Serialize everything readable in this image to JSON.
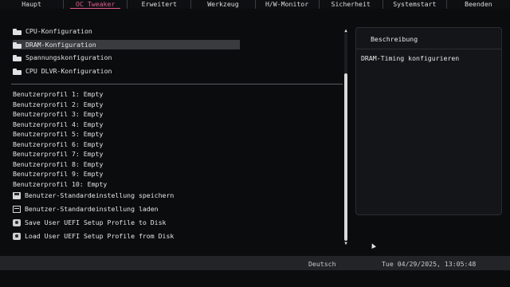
{
  "tabs": [
    {
      "label": "Haupt"
    },
    {
      "label": "OC Tweaker"
    },
    {
      "label": "Erweitert"
    },
    {
      "label": "Werkzeug"
    },
    {
      "label": "H/W-Monitor"
    },
    {
      "label": "Sicherheit"
    },
    {
      "label": "Systemstart"
    },
    {
      "label": "Beenden"
    }
  ],
  "active_tab": "OC Tweaker",
  "accent_color": "#e25b8c",
  "menu": [
    {
      "label": "CPU-Konfiguration",
      "icon": "folder-icon"
    },
    {
      "label": "DRAM-Konfiguration",
      "icon": "folder-icon",
      "selected": true
    },
    {
      "label": "Spannungskonfiguration",
      "icon": "folder-icon"
    },
    {
      "label": "CPU DLVR-Konfiguration",
      "icon": "folder-icon"
    }
  ],
  "profiles": [
    {
      "label": "Benutzerprofil 1: Empty"
    },
    {
      "label": "Benutzerprofil 2: Empty"
    },
    {
      "label": "Benutzerprofil 3: Empty"
    },
    {
      "label": "Benutzerprofil 4: Empty"
    },
    {
      "label": "Benutzerprofil 5: Empty"
    },
    {
      "label": "Benutzerprofil 6: Empty"
    },
    {
      "label": "Benutzerprofil 7: Empty"
    },
    {
      "label": "Benutzerprofil 8: Empty"
    },
    {
      "label": "Benutzerprofil 9: Empty"
    },
    {
      "label": "Benutzerprofil 10: Empty"
    }
  ],
  "actions": [
    {
      "label": "Benutzer-Standardeinstellung speichern",
      "icon": "save-icon"
    },
    {
      "label": "Benutzer-Standardeinstellung laden",
      "icon": "load-icon"
    },
    {
      "label": "Save User UEFI Setup Profile to Disk",
      "icon": "disk-save-icon"
    },
    {
      "label": "Load User UEFI Setup Profile from Disk",
      "icon": "disk-load-icon"
    }
  ],
  "description": {
    "title": "Beschreibung",
    "text": "DRAM-Timing konfigurieren"
  },
  "footer": {
    "language": "Deutsch",
    "datetime": "Tue 04/29/2025, 13:05:48"
  }
}
